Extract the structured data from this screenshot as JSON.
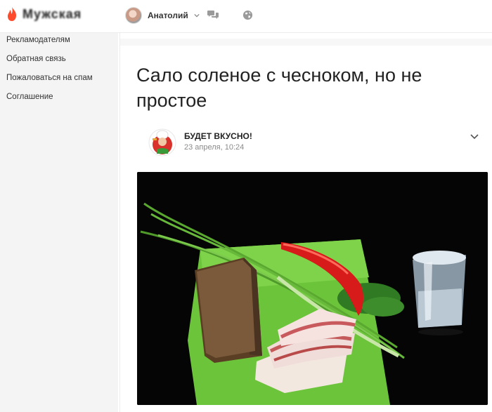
{
  "header": {
    "logo_text": "Мужская",
    "user_name": "Анатолий"
  },
  "sidebar": {
    "items": [
      {
        "label": "Рекламодателям"
      },
      {
        "label": "Обратная связь"
      },
      {
        "label": "Пожаловаться на спам"
      },
      {
        "label": "Соглашение"
      }
    ]
  },
  "post": {
    "title": "Сало соленое с чесноком, но не простое",
    "author": "БУДЕТ ВКУСНО!",
    "date": "23 апреля, 10:24"
  },
  "colors": {
    "accent": "#ff4a2b",
    "sidebar_bg": "#f4f4f4",
    "text": "#222222",
    "muted": "#8a8a8a"
  },
  "icons": {
    "logo": "flame-icon",
    "user_menu": "chevron-down-icon",
    "messages": "chat-bubbles-icon",
    "community": "globe-icon",
    "post_menu": "chevron-down-icon"
  }
}
